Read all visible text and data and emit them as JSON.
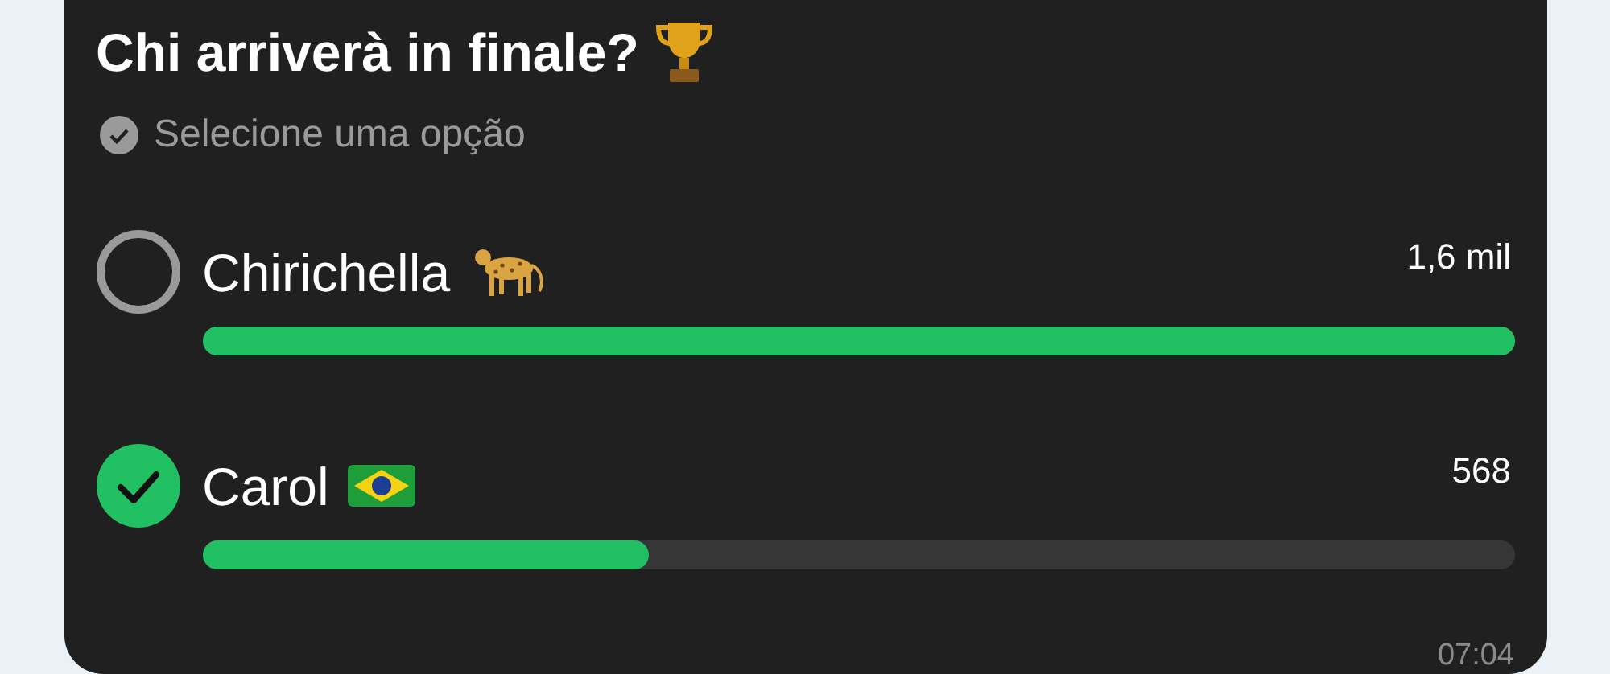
{
  "poll": {
    "question": "Chi arriverà in finale?",
    "hint": "Selecione uma opção",
    "options": [
      {
        "label": "Chirichella",
        "votes": "1,6 mil",
        "level": 1.0,
        "selected": false,
        "kind": "leopard"
      },
      {
        "label": "Carol",
        "votes": "568",
        "level": 0.34,
        "selected": true,
        "kind": "flag"
      }
    ],
    "time": "07:04"
  }
}
